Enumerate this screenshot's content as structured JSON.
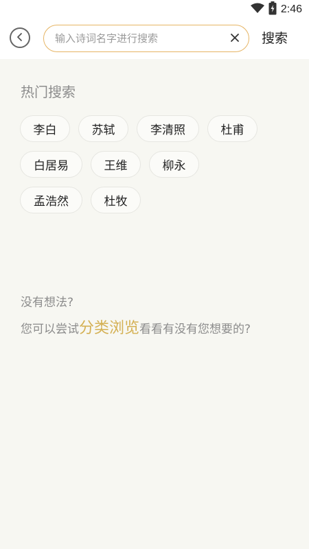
{
  "status_bar": {
    "time": "2:46",
    "wifi_icon": "wifi-icon",
    "battery_icon": "battery-charging-icon"
  },
  "header": {
    "back_icon": "chevron-left-icon",
    "search_placeholder": "输入诗词名字进行搜索",
    "search_value": "",
    "clear_icon": "close-icon",
    "search_button_label": "搜索",
    "accent_color": "#e6b463"
  },
  "hot_search": {
    "title": "热门搜索",
    "rows": [
      [
        "李白",
        "苏轼",
        "李清照",
        "杜甫"
      ],
      [
        "白居易",
        "王维",
        "柳永"
      ],
      [
        "孟浩然",
        "杜牧"
      ]
    ]
  },
  "hint": {
    "line1": "没有想法?",
    "line2_prefix": "您可以尝试",
    "line2_link": "分类浏览",
    "line2_suffix": "看看有没有您想要的?",
    "link_color": "#d4b053"
  }
}
